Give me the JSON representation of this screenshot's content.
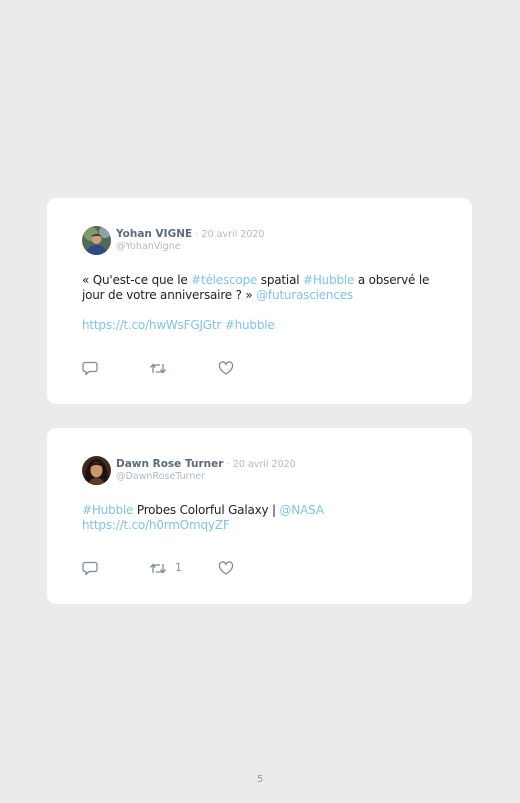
{
  "tweets": [
    {
      "author": "Yohan VIGNE",
      "date": "· 20 avril 2020",
      "handle": "@YohanVigne",
      "text": {
        "t1": "« Qu'est-ce que le ",
        "h1": "#télescope",
        "t2": " spatial ",
        "h2": "#Hubble",
        "t3": " a observé le jour de votre anniversaire ? » ",
        "m1": "@futurasciences",
        "url": "https://t.co/hwWsFGJGtr",
        "h3": "#hubble"
      },
      "icons": [
        "reply-icon",
        "retweet-icon",
        "like-icon"
      ]
    },
    {
      "author": "Dawn Rose Turner",
      "date": "· 20 avril 2020",
      "handle": "@DawnRoseTurner",
      "text": {
        "h1": "#Hubble",
        "t1": " Probes Colorful Galaxy | ",
        "m1": "@NASA",
        "url": "https://t.co/h0rmOmqyZF"
      },
      "retweet_count": "1",
      "icons": [
        "reply-icon",
        "retweet-icon",
        "like-icon"
      ]
    }
  ],
  "page_number": "5",
  "colors": {
    "background": "#ebebeb",
    "card": "#ffffff",
    "link": "#7fc3ea",
    "author": "#5a6b7d",
    "muted": "#b3b9c0",
    "icon": "#7d8b99"
  }
}
